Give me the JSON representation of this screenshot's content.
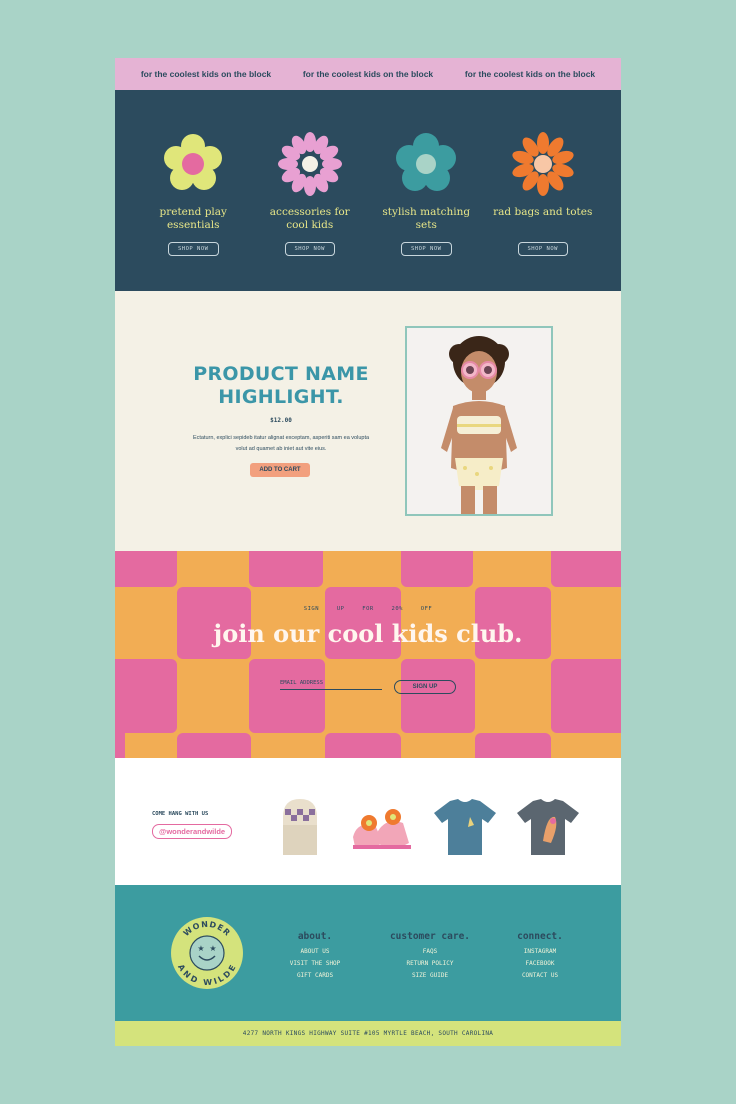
{
  "marquee": [
    "for the coolest kids on the block",
    "for the coolest kids on the block",
    "for the coolest kids on the block"
  ],
  "categories": [
    {
      "label": "pretend play essentials",
      "button": "SHOP NOW",
      "petal_color": "#e0e67a",
      "center_color": "#e46aa0"
    },
    {
      "label": "accessories for cool kids",
      "button": "SHOP NOW",
      "petal_color": "#e8a0d2",
      "center_color": "#f4f1e6"
    },
    {
      "label": "stylish matching sets",
      "button": "SHOP NOW",
      "petal_color": "#3c9ca0",
      "center_color": "#a9d3c7"
    },
    {
      "label": "rad bags and totes",
      "button": "SHOP NOW",
      "petal_color": "#ef7a2f",
      "center_color": "#f8c7a6"
    }
  ],
  "product": {
    "title": "PRODUCT NAME HIGHLIGHT.",
    "price": "$12.00",
    "description": "Ectaturn, explici sepideb itatur alignat exceptam, asperiti sam ea volupta volut ad quamet ab iniet aut vite eius.",
    "add_to_cart": "ADD TO CART"
  },
  "club": {
    "signup_text": "SIGN UP FOR 20% OFF",
    "title": "join our cool kids club.",
    "email_placeholder": "EMAIL ADDRESS",
    "signup_button": "SIGN UP"
  },
  "social": {
    "hang": "COME HANG WITH US",
    "handle": "@wonderandwilde",
    "products": [
      "beanie",
      "flower-sandals",
      "blue-tee",
      "grey-tee"
    ]
  },
  "footer": {
    "logo_top": "WONDER",
    "logo_bottom": "AND WILDE",
    "columns": [
      {
        "title": "about.",
        "links": [
          "ABOUT US",
          "VISIT THE SHOP",
          "GIFT CARDS"
        ]
      },
      {
        "title": "customer care.",
        "links": [
          "FAQS",
          "RETURN POLICY",
          "SIZE GUIDE"
        ]
      },
      {
        "title": "connect.",
        "links": [
          "INSTAGRAM",
          "FACEBOOK",
          "CONTACT US"
        ]
      }
    ],
    "address": "4277 NORTH KINGS HIGHWAY SUITE #105 MYRTLE BEACH, SOUTH CAROLINA"
  },
  "colors": {
    "background": "#a9d3c7",
    "navy": "#2c4b5e",
    "cream": "#f4f1e6",
    "teal": "#3c9ca0",
    "pink": "#e46aa0",
    "orange": "#f2ad54",
    "yellow_green": "#d4e37c",
    "lilac": "#e5b3d4"
  }
}
